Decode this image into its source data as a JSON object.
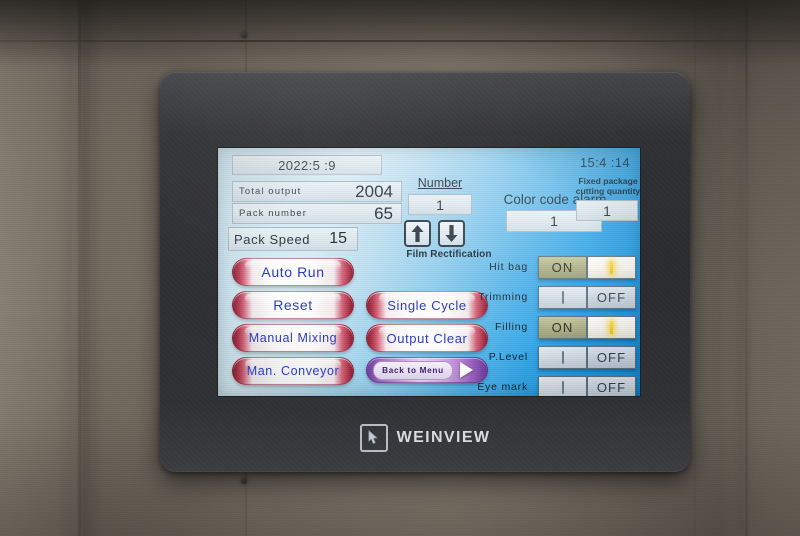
{
  "device": {
    "brand": "WEINVIEW",
    "brand_mark_icon": "cursor-in-square-icon"
  },
  "screen": {
    "date": "2022:5 :9",
    "time": "15:4 :14",
    "stats": [
      {
        "label": "Total  output",
        "value": "2004"
      },
      {
        "label": "Pack  number",
        "value": "65"
      }
    ],
    "pack_speed": {
      "label": "Pack  Speed",
      "value": "15"
    },
    "number": {
      "label": "Number",
      "value": "1"
    },
    "film_rectification": {
      "caption": "Film Rectification",
      "up_icon": "arrow-up-icon",
      "down_icon": "arrow-down-icon"
    },
    "color_code_alarm": {
      "label": "Color code alarm",
      "value": "1"
    },
    "fixed_package": {
      "label": "Fixed package cutting quantity",
      "value": "1"
    },
    "buttons": [
      {
        "key": "auto_run",
        "label": "Auto Run"
      },
      {
        "key": "reset",
        "label": "Reset"
      },
      {
        "key": "manual_mixing",
        "label": "Manual Mixing"
      },
      {
        "key": "man_conveyor",
        "label": "Man. Conveyor"
      },
      {
        "key": "single_cycle",
        "label": "Single Cycle"
      },
      {
        "key": "output_clear",
        "label": "Output Clear"
      }
    ],
    "back_to_menu": {
      "label": "Back to Menu",
      "arrow_icon": "arrow-right-icon"
    },
    "toggles": [
      {
        "key": "hit_bag",
        "label": "Hit bag",
        "state": "ON",
        "on_text": "ON",
        "off_text": "OFF"
      },
      {
        "key": "trimming",
        "label": "Trimming",
        "state": "OFF",
        "on_text": "ON",
        "off_text": "OFF"
      },
      {
        "key": "filling",
        "label": "Filling",
        "state": "ON",
        "on_text": "ON",
        "off_text": "OFF"
      },
      {
        "key": "p_level",
        "label": "P.Level",
        "state": "OFF",
        "on_text": "ON",
        "off_text": "OFF"
      },
      {
        "key": "eye_mark",
        "label": "Eye mark",
        "state": "OFF",
        "on_text": "ON",
        "off_text": "OFF"
      }
    ]
  },
  "colors": {
    "lcd_blue": "#1593e4",
    "lcd_pale": "#cfe9f4",
    "button_red": "#8c1f34",
    "button_text": "#2b3cc4",
    "back_purple": "#8b52b4",
    "on_olive": "#a9ad83",
    "lamp_yellow": "#f5c20a",
    "bezel": "#2b2c30"
  }
}
